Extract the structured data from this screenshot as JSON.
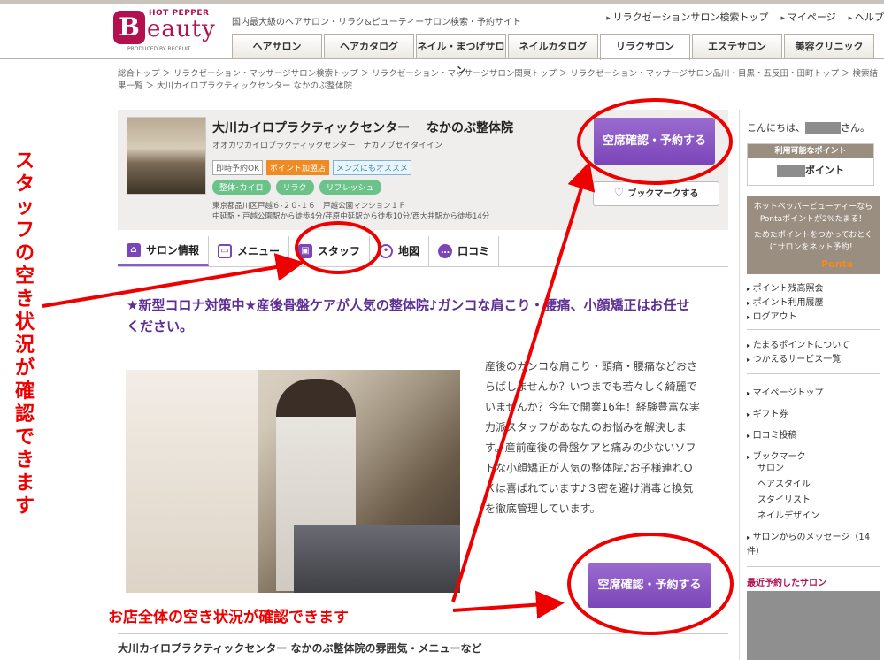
{
  "header": {
    "logo": {
      "top": "HOT PEPPER",
      "letter": "B",
      "word": "eauty",
      "produced": "PRODUCED BY RECRUIT"
    },
    "tagline": "国内最大級のヘアサロン・リラク&ビューティーサロン検索・予約サイト",
    "links": [
      "リラクゼーションサロン検索トップ",
      "マイページ",
      "ヘルプ"
    ],
    "tabs": [
      "ヘアサロン",
      "ヘアカタログ",
      "ネイル・まつげサロン",
      "ネイルカタログ",
      "リラクサロン",
      "エステサロン",
      "美容クリニック"
    ],
    "active_tab": 4
  },
  "breadcrumb": "総合トップ ＞ リラクゼーション・マッサージサロン検索トップ ＞ リラクゼーション・マッサージサロン関東トップ ＞ リラクゼーション・マッサージサロン品川・目黒・五反田・田町トップ ＞ 検索結果一覧 ＞ 大川カイロプラクティックセンター なかのぶ整体院",
  "salon": {
    "name": "大川カイロプラクティックセンター　 なかのぶ整体院",
    "kana": "オオカワカイロプラクティックセンター　ナカノブセイタイイン",
    "tags": [
      "即時予約OK",
      "ポイント加盟店",
      "メンズにもオススメ"
    ],
    "pills": [
      "整体･カイロ",
      "リラク",
      "リフレッシュ"
    ],
    "address": "東京都品川区戸越６-２０-１６　戸越公園マンション１Ｆ",
    "access": "中延駅・戸越公園駅から徒歩4分/荏原中延駅から徒歩10分/西大井駅から徒歩14分",
    "reserve_label": "空席確認・予約する",
    "bookmark_label": "ブックマークする"
  },
  "subtabs": [
    {
      "label": "サロン情報",
      "icon": "home-icon"
    },
    {
      "label": "メニュー",
      "icon": "book-icon"
    },
    {
      "label": "スタッフ",
      "icon": "staff-card-icon"
    },
    {
      "label": "地図",
      "icon": "map-pin-icon"
    },
    {
      "label": "口コミ",
      "icon": "chat-icon"
    }
  ],
  "catch": "★新型コロナ対策中★産後骨盤ケアが人気の整体院♪ガンコな肩こり・腰痛、小顔矯正はお任せください。",
  "description": "産後のガンコな肩こり・頭痛・腰痛などおさらばしませんか？いつまでも若々しく綺麗でいませんか？今年で開業16年！経験豊富な実力派スタッフがあなたのお悩みを解決します。産前産後の骨盤ケアと痛みの少ないソフトな小顔矯正が人気の整体院♪お子様連れＯＫは喜ばれています♪３密を避け消毒と換気を徹底管理しています。",
  "reserve2_label": "空席確認・予約する",
  "bottom_title": "大川カイロプラクティックセンター なかのぶ整体院の雰囲気・メニューなど",
  "sidebar": {
    "greet_prefix": "こんにちは、",
    "greet_suffix": "さん。",
    "points_header": "利用可能なポイント",
    "points_suffix": "ポイント",
    "ponta_text1": "ホットペッパービューティーなら",
    "ponta_text2": "Pontaポイントが2%たまる！",
    "ponta_text3": "ためたポイントをつかっておとくにサロンをネット予約！",
    "ponta_logo": "Ponta",
    "list1": [
      "ポイント残高照会",
      "ポイント利用履歴",
      "ログアウト"
    ],
    "list2": [
      "たまるポイントについて",
      "つかえるサービス一覧"
    ],
    "list3": [
      "マイページトップ",
      "ギフト券",
      "口コミ投稿",
      "ブックマーク"
    ],
    "list3_sub": [
      "サロン",
      "ヘアスタイル",
      "スタイリスト",
      "ネイルデザイン"
    ],
    "list4": [
      "サロンからのメッセージ（14件）"
    ],
    "recent_title": "最近予約したサロン"
  },
  "annotations": {
    "vertical": "スタッフの空き状況が確認できます",
    "horizontal": "お店全体の空き状況が確認できます"
  },
  "colors": {
    "brand": "#b2104e",
    "accent": "#7b45b8",
    "annotation": "#ee0000"
  }
}
